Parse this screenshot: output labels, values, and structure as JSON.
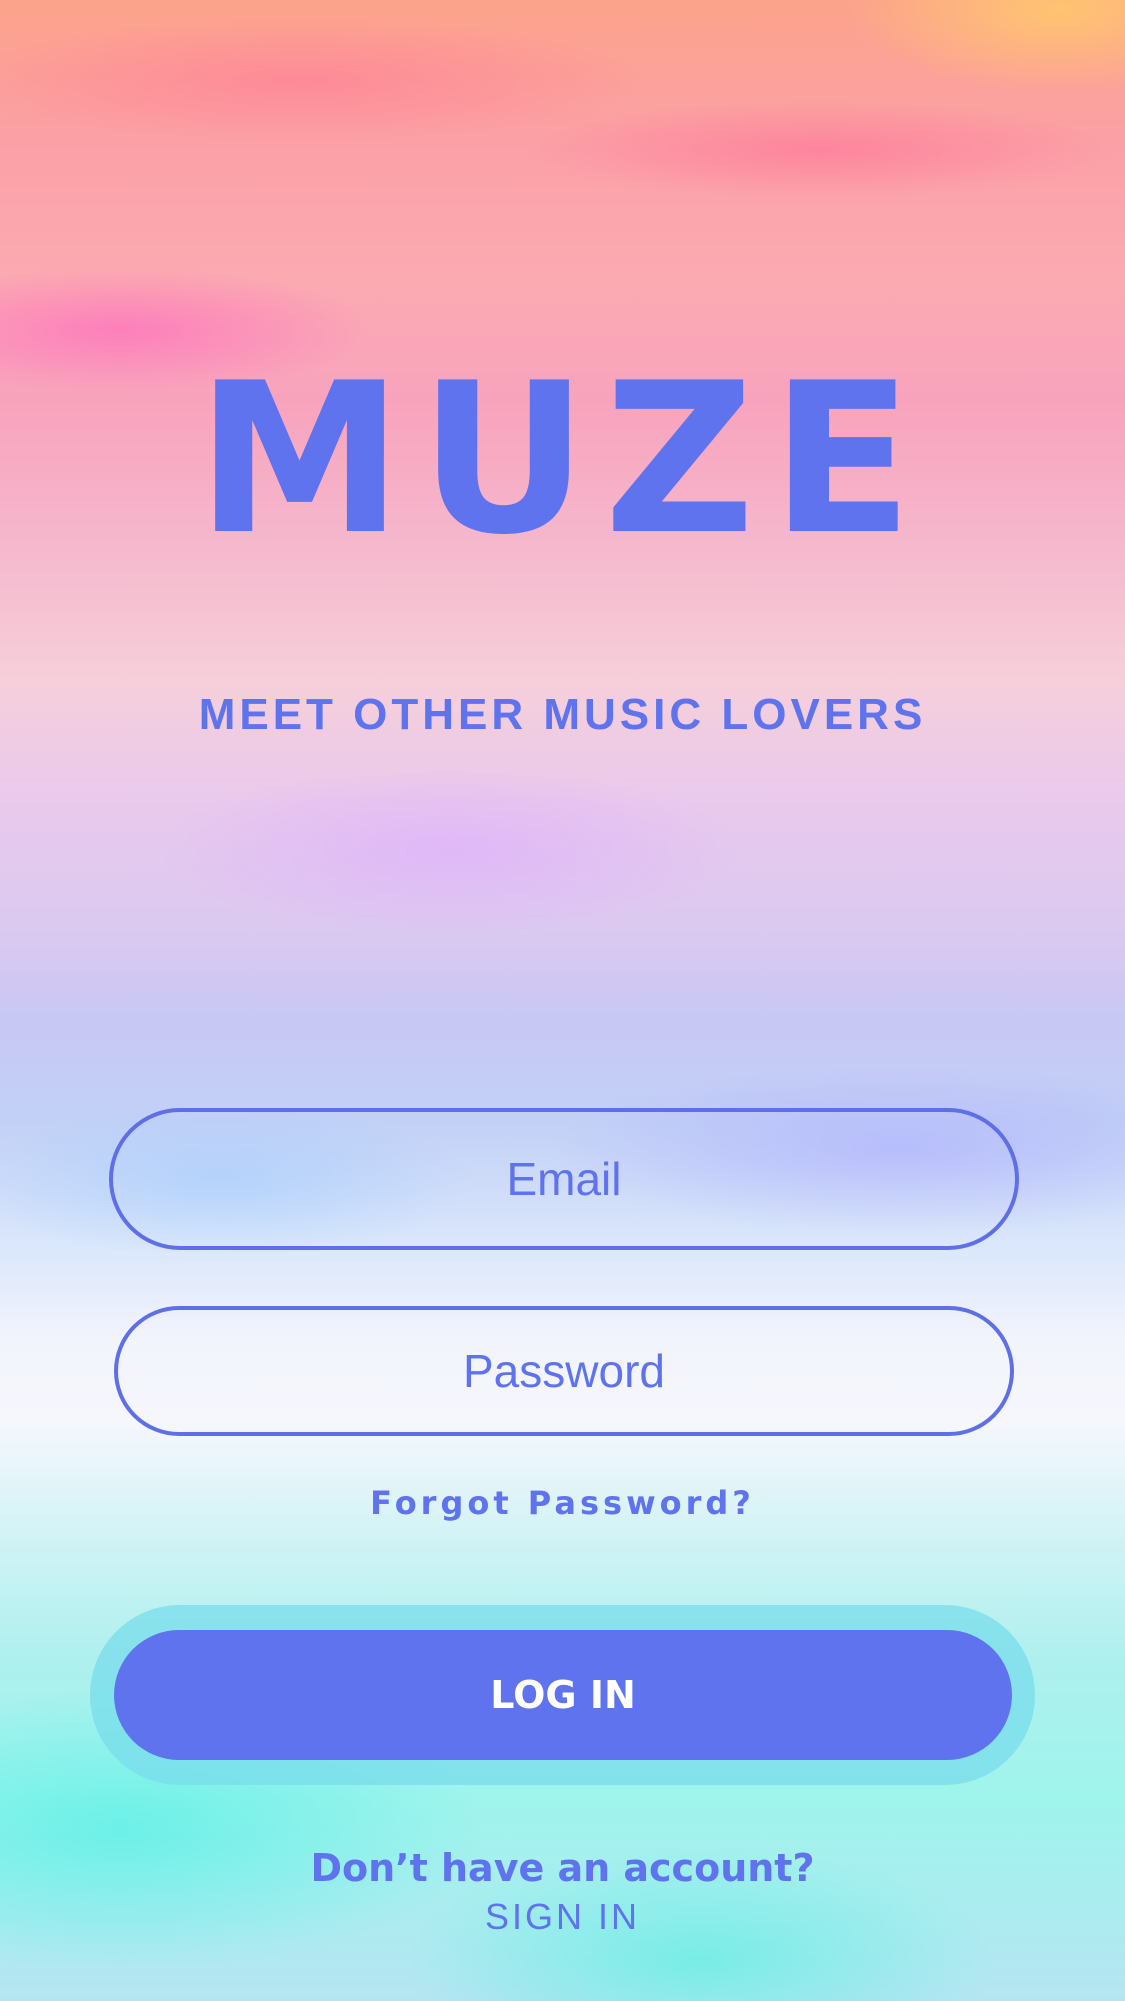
{
  "app": {
    "logo_text": "MUZE",
    "tagline": "MEET OTHER MUSIC LOVERS"
  },
  "login_form": {
    "email_placeholder": "Email",
    "password_placeholder": "Password",
    "forgot_password_label": "Forgot Password?",
    "login_button_label": "LOG IN"
  },
  "signup": {
    "prompt": "Don’t have an account?",
    "link_label": "SIGN IN"
  },
  "colors": {
    "accent": "#5f73ee",
    "button_text": "#ffffff",
    "button_glow": "#7fdcea"
  }
}
